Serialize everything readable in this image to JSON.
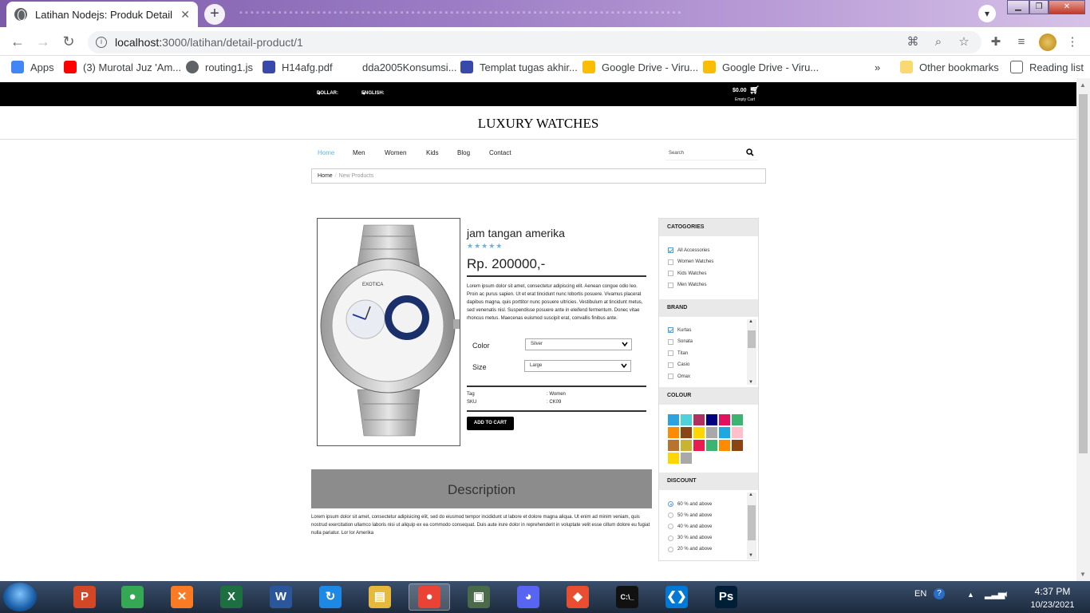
{
  "browser": {
    "tab_title": "Latihan Nodejs: Produk Detail",
    "tab_close": "✕",
    "new_tab": "+",
    "url_host": "localhost:",
    "url_path": "3000/latihan/detail-product/1",
    "bookmarks": [
      {
        "label": "Apps",
        "icon": "apps-grid-icon",
        "color": "#4285f4"
      },
      {
        "label": "(3) Murotal Juz 'Am...",
        "icon": "youtube-icon",
        "color": "#ff0000"
      },
      {
        "label": "routing1.js",
        "icon": "globe-icon",
        "color": "#5f6368"
      },
      {
        "label": "H14afg.pdf",
        "icon": "pdf-icon",
        "color": "#3949ab"
      },
      {
        "label": "dda2005Konsumsi...",
        "icon": "blank-icon",
        "color": "#ffffff"
      },
      {
        "label": "Templat tugas akhir...",
        "icon": "pdf-icon",
        "color": "#3949ab"
      },
      {
        "label": "Google Drive - Viru...",
        "icon": "google-drive-icon",
        "color": "#fbbc04"
      },
      {
        "label": "Google Drive - Viru...",
        "icon": "google-drive-icon",
        "color": "#fbbc04"
      }
    ],
    "more_bookmarks": "»",
    "other_bookmarks": "Other bookmarks",
    "reading_list": "Reading list"
  },
  "topbar": {
    "currency": "DOLLAR:",
    "language": "ENGLISH:",
    "cart_total": "$0.00",
    "cart_status": "Empty Cart"
  },
  "site": {
    "title": "LUXURY WATCHES",
    "nav": [
      "Home",
      "Men",
      "Women",
      "Kids",
      "Blog",
      "Contact"
    ],
    "search_placeholder": "Search",
    "breadcrumb": {
      "home": "Home",
      "sep": "/",
      "current": "New Products"
    }
  },
  "product": {
    "name": "jam tangan amerika",
    "stars": "★★★★★",
    "rating": 5,
    "price": "Rp. 200000,-",
    "description": "Lorem ipsum dolor sit amet, consectetur adipiscing elit. Aenean congue odio leo. Proin ac purus sapien. Ut et erat tincidunt nunc lobortis posuere. Vivamus placerat dapibus magna, quis porttitor nunc posuere ultricies. Vestibulum at tincidunt metus, sed venenatis nisl. Suspendisse posuere ante in eleifend fermentum. Donec vitae rhoncus metus. Maecenas euismod suscipit erat, convallis finibus ante.",
    "color_label": "Color",
    "color_value": "Silver",
    "size_label": "Size",
    "size_value": "Large",
    "tag_label": "Tag",
    "tag_value": ": Women",
    "sku_label": "SKU",
    "sku_value": ": CK09",
    "add_to_cart": "ADD TO CART",
    "description_heading": "Description",
    "long_description": "Lorem ipsum dolor sit amet, consectetur adipisicing elit, sed do eiusmod tempor incididunt ut labore et dolore magna aliqua. Ut enim ad minim veniam, quis nostrud exercitation ullamco laboris nisi ut aliquip ex ea commodo consequat. Duis aute irure dolor in reprehenderit in voluptate velit esse cillum dolore eu fugiat nulla pariatur. Lor lor Amerika"
  },
  "sidebar": {
    "categories_title": "CATOGORIES",
    "categories": [
      {
        "label": "All Accessories",
        "checked": true
      },
      {
        "label": "Women Watches",
        "checked": false
      },
      {
        "label": "Kids Watches",
        "checked": false
      },
      {
        "label": "Men Watches",
        "checked": false
      }
    ],
    "brand_title": "BRAND",
    "brands": [
      {
        "label": "Kurtas",
        "checked": true
      },
      {
        "label": "Sonata",
        "checked": false
      },
      {
        "label": "Titan",
        "checked": false
      },
      {
        "label": "Casio",
        "checked": false
      },
      {
        "label": "Omax",
        "checked": false
      }
    ],
    "colour_title": "COLOUR",
    "swatches": [
      "#2aa3e0",
      "#4fd1d9",
      "#b03060",
      "#000080",
      "#e0115f",
      "#3cb371",
      "#ff8c00",
      "#8b4513",
      "#ffd700",
      "#a9a9a9",
      "#1ea7e1",
      "#ffc0cb",
      "#b8732e",
      "#c8b432",
      "#e81c4f",
      "#3cb371",
      "#ff8c00",
      "#8b4513",
      "#ffd700",
      "#a9a9a9"
    ],
    "discount_title": "DISCOUNT",
    "discounts": [
      {
        "label": "60 % and above",
        "checked": true
      },
      {
        "label": "50 % and above",
        "checked": false
      },
      {
        "label": "40 % and above",
        "checked": false
      },
      {
        "label": "30 % and above",
        "checked": false
      },
      {
        "label": "20 % and above",
        "checked": false
      }
    ]
  },
  "taskbar": {
    "apps": [
      {
        "name": "powerpoint-icon",
        "glyph": "P",
        "color": "#d24726",
        "active": false
      },
      {
        "name": "chrome-icon",
        "glyph": "●",
        "color": "#34a853",
        "active": false
      },
      {
        "name": "xampp-icon",
        "glyph": "✕",
        "color": "#fb7a24",
        "active": false
      },
      {
        "name": "excel-icon",
        "glyph": "X",
        "color": "#1d6f42",
        "active": false
      },
      {
        "name": "word-icon",
        "glyph": "W",
        "color": "#2b579a",
        "active": false
      },
      {
        "name": "sync-icon",
        "glyph": "↻",
        "color": "#1e88e5",
        "active": false
      },
      {
        "name": "file-explorer-icon",
        "glyph": "▤",
        "color": "#e6b93c",
        "active": false
      },
      {
        "name": "chrome-icon",
        "glyph": "●",
        "color": "#ea4335",
        "active": true
      },
      {
        "name": "device-manager-icon",
        "glyph": "▣",
        "color": "#4a6a4a",
        "active": false
      },
      {
        "name": "discord-icon",
        "glyph": "◕",
        "color": "#5865f2",
        "active": false
      },
      {
        "name": "git-icon",
        "glyph": "◆",
        "color": "#e94e31",
        "active": false
      },
      {
        "name": "cmd-icon",
        "glyph": "C:\\_",
        "color": "#111111",
        "active": false
      },
      {
        "name": "vscode-icon",
        "glyph": "❮❯",
        "color": "#0078d4",
        "active": false
      },
      {
        "name": "photoshop-icon",
        "glyph": "Ps",
        "color": "#001e36",
        "active": false
      }
    ],
    "language": "EN",
    "time": "4:37 PM",
    "date": "10/23/2021"
  }
}
